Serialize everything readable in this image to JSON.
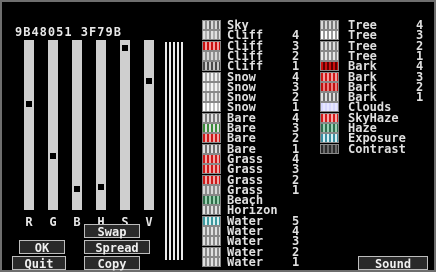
{
  "hex_readout": "9B48051 3F79B",
  "sliders": [
    {
      "label": "R",
      "level": 0.63
    },
    {
      "label": "G",
      "level": 0.31
    },
    {
      "label": "B",
      "level": 0.11
    },
    {
      "label": "H",
      "level": 0.12
    },
    {
      "label": "S",
      "level": 0.97
    },
    {
      "label": "V",
      "level": 0.77
    }
  ],
  "buttons": {
    "swap": "Swap",
    "ok": "OK",
    "spread": "Spread",
    "quit": "Quit",
    "copy": "Copy",
    "sound": "Sound"
  },
  "left_list": [
    {
      "name": "Sky",
      "num": "",
      "palette": [
        "#d8d8d8",
        "#8a8a8a",
        "#d8d8d8",
        "#6a6a6a"
      ]
    },
    {
      "name": "Cliff",
      "num": "4",
      "palette": [
        "#e0e0e0",
        "#b0b0b0",
        "#e0e0e0",
        "#909090"
      ]
    },
    {
      "name": "Cliff",
      "num": "3",
      "palette": [
        "#c81010",
        "#f2a0a0",
        "#c81010",
        "#f2a0a0"
      ]
    },
    {
      "name": "Cliff",
      "num": "2",
      "palette": [
        "#d8d8d8",
        "#909090",
        "#d8d8d8",
        "#909090"
      ]
    },
    {
      "name": "Cliff",
      "num": "1",
      "palette": [
        "#4a4a4a",
        "#c8c8c8",
        "#4a4a4a",
        "#c8c8c8"
      ]
    },
    {
      "name": "Snow",
      "num": "4",
      "palette": [
        "#f0f0f0",
        "#a8a8a8",
        "#f0f0f0",
        "#a8a8a8"
      ]
    },
    {
      "name": "Snow",
      "num": "3",
      "palette": [
        "#f4f4f4",
        "#b8b8b8",
        "#f4f4f4",
        "#b8b8b8"
      ]
    },
    {
      "name": "Snow",
      "num": "2",
      "palette": [
        "#e8e8e8",
        "#9a9a9a",
        "#e8e8e8",
        "#9a9a9a"
      ]
    },
    {
      "name": "Snow",
      "num": "1",
      "palette": [
        "#ffffff",
        "#bdbdbd",
        "#ffffff",
        "#bdbdbd"
      ]
    },
    {
      "name": "Bare",
      "num": "4",
      "palette": [
        "#e0e0e0",
        "#7a7a7a",
        "#e0e0e0",
        "#7a7a7a"
      ]
    },
    {
      "name": "Bare",
      "num": "3",
      "palette": [
        "#3a8a3a",
        "#e0e0e0",
        "#3a8a3a",
        "#e0e0e0"
      ]
    },
    {
      "name": "Bare",
      "num": "2",
      "palette": [
        "#cc1818",
        "#f0a8a8",
        "#cc1818",
        "#f0a8a8"
      ]
    },
    {
      "name": "Bare",
      "num": "1",
      "palette": [
        "#e0e0e0",
        "#707070",
        "#e0e0e0",
        "#707070"
      ]
    },
    {
      "name": "Grass",
      "num": "4",
      "palette": [
        "#cc1818",
        "#f0a8a8",
        "#cc1818",
        "#f0a8a8"
      ]
    },
    {
      "name": "Grass",
      "num": "3",
      "palette": [
        "#cc1818",
        "#f0a8a8",
        "#cc1818",
        "#f0a8a8"
      ]
    },
    {
      "name": "Grass",
      "num": "2",
      "palette": [
        "#cc1818",
        "#f0a8a8",
        "#cc1818",
        "#f0a8a8"
      ]
    },
    {
      "name": "Grass",
      "num": "1",
      "palette": [
        "#d8d8d8",
        "#8a8a8a",
        "#d8d8d8",
        "#8a8a8a"
      ]
    },
    {
      "name": "Beach",
      "num": "",
      "palette": [
        "#2f6e4a",
        "#9ad0b0",
        "#2f6e4a",
        "#9ad0b0"
      ]
    },
    {
      "name": "Horizon",
      "num": "",
      "palette": [
        "#e0e0e0",
        "#808080",
        "#e0e0e0",
        "#808080"
      ]
    },
    {
      "name": "Water",
      "num": "5",
      "palette": [
        "#3f9aa0",
        "#d8f0f0",
        "#3f9aa0",
        "#d8f0f0"
      ]
    },
    {
      "name": "Water",
      "num": "4",
      "palette": [
        "#e0e0e0",
        "#8a8a8a",
        "#e0e0e0",
        "#8a8a8a"
      ]
    },
    {
      "name": "Water",
      "num": "3",
      "palette": [
        "#e0e0e0",
        "#8a8a8a",
        "#e0e0e0",
        "#8a8a8a"
      ]
    },
    {
      "name": "Water",
      "num": "2",
      "palette": [
        "#e0e0e0",
        "#8a8a8a",
        "#e0e0e0",
        "#8a8a8a"
      ]
    },
    {
      "name": "Water",
      "num": "1",
      "palette": [
        "#e0e0e0",
        "#8a8a8a",
        "#e0e0e0",
        "#8a8a8a"
      ]
    }
  ],
  "right_list": [
    {
      "name": "Tree",
      "num": "4",
      "palette": [
        "#d8d8d8",
        "#7a7a7a",
        "#d8d8d8",
        "#7a7a7a"
      ]
    },
    {
      "name": "Tree",
      "num": "3",
      "palette": [
        "#ffffff",
        "#9a9a9a",
        "#ffffff",
        "#9a9a9a"
      ]
    },
    {
      "name": "Tree",
      "num": "2",
      "palette": [
        "#e0e0e0",
        "#808080",
        "#e0e0e0",
        "#808080"
      ]
    },
    {
      "name": "Tree",
      "num": "1",
      "palette": [
        "#e8e8e8",
        "#909090",
        "#e8e8e8",
        "#909090"
      ]
    },
    {
      "name": "Bark",
      "num": "4",
      "palette": [
        "#cc1010",
        "#5a0000",
        "#cc1010",
        "#5a0000"
      ]
    },
    {
      "name": "Bark",
      "num": "3",
      "palette": [
        "#d01818",
        "#f0a0a0",
        "#d01818",
        "#f0a0a0"
      ]
    },
    {
      "name": "Bark",
      "num": "2",
      "palette": [
        "#c01010",
        "#e88080",
        "#c01010",
        "#e88080"
      ]
    },
    {
      "name": "Bark",
      "num": "1",
      "palette": [
        "#e0e0e0",
        "#707070",
        "#e0e0e0",
        "#707070"
      ]
    },
    {
      "name": "Clouds",
      "num": "",
      "palette": [
        "#d8d8ff",
        "#e8e8ff",
        "#d8d8ff",
        "#e8e8ff"
      ]
    },
    {
      "name": "SkyHaze",
      "num": "",
      "palette": [
        "#d21a1a",
        "#f4aaaa",
        "#d21a1a",
        "#f4aaaa"
      ]
    },
    {
      "name": "Haze",
      "num": "",
      "palette": [
        "#2e6e4e",
        "#9ad0b4",
        "#2e6e4e",
        "#9ad0b4"
      ]
    },
    {
      "name": "Exposure",
      "num": "",
      "palette": [
        "#3a8ea0",
        "#d8f0f4",
        "#3a8ea0",
        "#d8f0f4"
      ]
    },
    {
      "name": "Contrast",
      "num": "",
      "palette": [
        "#2a2a2a",
        "#6a6a6a",
        "#2a2a2a",
        "#6a6a6a"
      ]
    }
  ]
}
